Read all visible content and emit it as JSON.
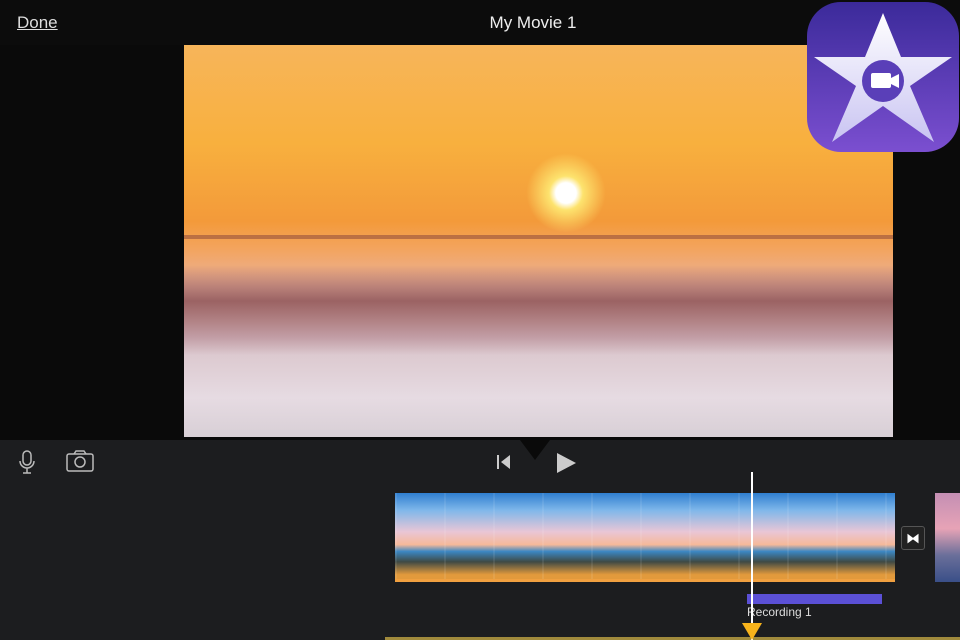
{
  "header": {
    "done_label": "Done",
    "title": "My Movie 1"
  },
  "timeline": {
    "recording_label": "Recording 1"
  },
  "colors": {
    "recording": "#5b50d6",
    "playhead_marker": "#f7b31b"
  }
}
